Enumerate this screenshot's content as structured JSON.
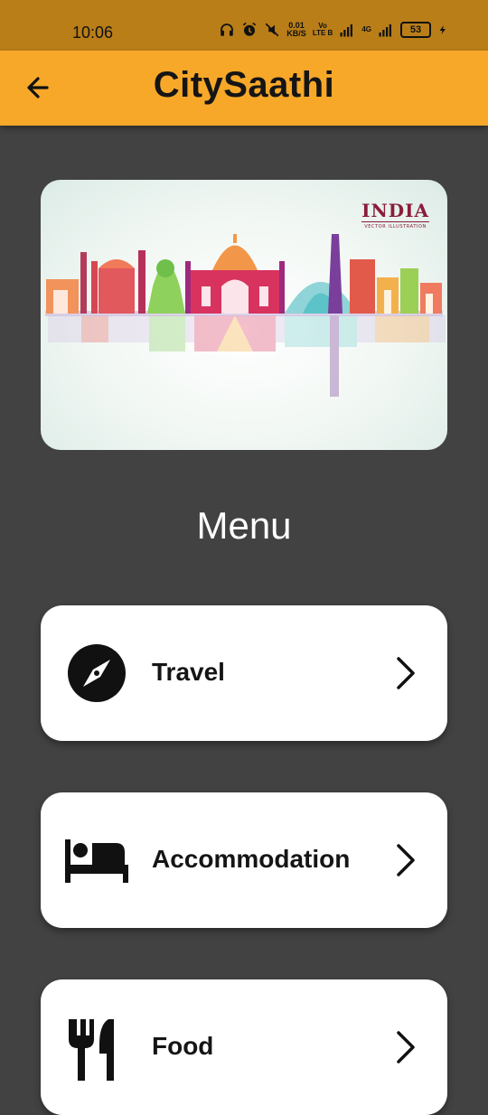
{
  "status_bar": {
    "time": "10:06",
    "net_speed_value": "0.01",
    "net_speed_unit": "KB/S",
    "volte_top": "Vo",
    "volte_bottom": "LTE B",
    "network": "4G",
    "battery": "53",
    "icons": [
      "headphones-icon",
      "alarm-icon",
      "mute-icon",
      "signal-icon",
      "charging-icon"
    ]
  },
  "app_bar": {
    "title": "CitySaathi",
    "back_icon": "arrow-back-icon",
    "background": "#F7A829"
  },
  "banner": {
    "brand_title": "INDIA",
    "brand_subtitle": "VECTOR ILLUSTRATION"
  },
  "menu": {
    "heading": "Menu",
    "items": [
      {
        "label": "Travel",
        "icon": "compass-icon"
      },
      {
        "label": "Accommodation",
        "icon": "bed-icon"
      },
      {
        "label": "Food",
        "icon": "fork-knife-icon"
      }
    ]
  },
  "colors": {
    "status_bar": "#B97E18",
    "app_bar": "#F7A829",
    "background": "#424242",
    "card": "#FFFFFF"
  }
}
